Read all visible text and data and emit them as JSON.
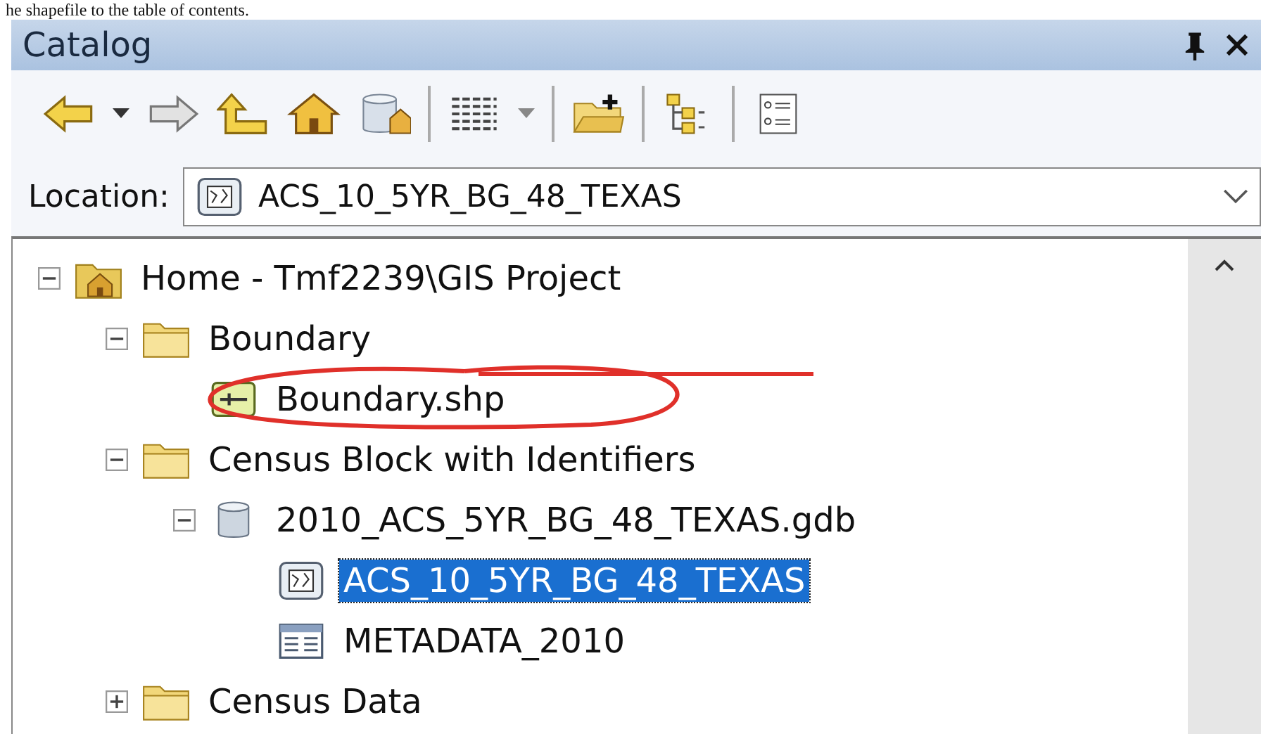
{
  "caption": "he shapefile to the table of contents.",
  "window": {
    "title": "Catalog"
  },
  "location": {
    "label": "Location:",
    "value": "ACS_10_5YR_BG_48_TEXAS"
  },
  "tree": [
    {
      "label": "Home - Tmf2239\\GIS Project",
      "kind": "home",
      "expanded": true,
      "selected": false,
      "children": [
        {
          "label": "Boundary",
          "kind": "folder",
          "expanded": true,
          "selected": false,
          "children": [
            {
              "label": "Boundary.shp",
              "kind": "shapefile",
              "selected": false
            }
          ]
        },
        {
          "label": "Census Block with Identifiers",
          "kind": "folder",
          "expanded": true,
          "selected": false,
          "children": [
            {
              "label": "2010_ACS_5YR_BG_48_TEXAS.gdb",
              "kind": "geodatabase",
              "expanded": true,
              "selected": false,
              "children": [
                {
                  "label": "ACS_10_5YR_BG_48_TEXAS",
                  "kind": "raster",
                  "selected": true
                },
                {
                  "label": "METADATA_2010",
                  "kind": "table",
                  "selected": false
                }
              ]
            }
          ]
        },
        {
          "label": "Census Data",
          "kind": "folder",
          "expanded": false,
          "selected": false
        }
      ]
    }
  ]
}
